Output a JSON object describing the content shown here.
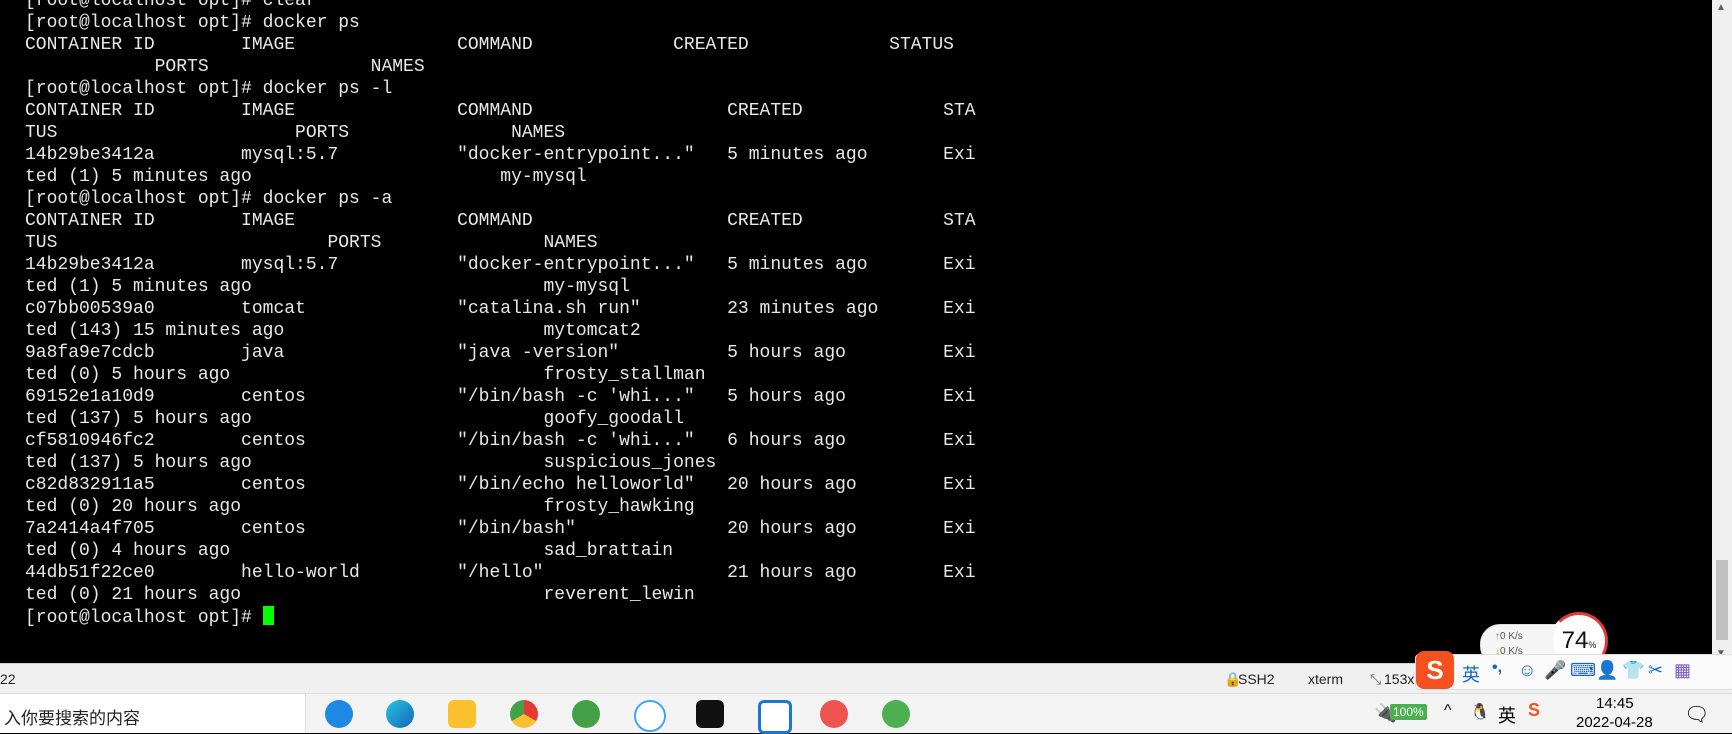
{
  "terminal": {
    "lines": [
      "[root@localhost opt]# clear",
      "[root@localhost opt]# docker ps",
      "CONTAINER ID        IMAGE               COMMAND             CREATED             STATUS",
      "            PORTS               NAMES",
      "[root@localhost opt]# docker ps -l",
      "CONTAINER ID        IMAGE               COMMAND                  CREATED             STA",
      "TUS                      PORTS               NAMES",
      "14b29be3412a        mysql:5.7           \"docker-entrypoint...\"   5 minutes ago       Exi",
      "ted (1) 5 minutes ago                       my-mysql",
      "[root@localhost opt]# docker ps -a",
      "CONTAINER ID        IMAGE               COMMAND                  CREATED             STA",
      "TUS                         PORTS               NAMES",
      "14b29be3412a        mysql:5.7           \"docker-entrypoint...\"   5 minutes ago       Exi",
      "ted (1) 5 minutes ago                           my-mysql",
      "c07bb00539a0        tomcat              \"catalina.sh run\"        23 minutes ago      Exi",
      "ted (143) 15 minutes ago                        mytomcat2",
      "9a8fa9e7cdcb        java                \"java -version\"          5 hours ago         Exi",
      "ted (0) 5 hours ago                             frosty_stallman",
      "69152e1a10d9        centos              \"/bin/bash -c 'whi...\"   5 hours ago         Exi",
      "ted (137) 5 hours ago                           goofy_goodall",
      "cf5810946fc2        centos              \"/bin/bash -c 'whi...\"   6 hours ago         Exi",
      "ted (137) 5 hours ago                           suspicious_jones",
      "c82d832911a5        centos              \"/bin/echo helloworld\"   20 hours ago        Exi",
      "ted (0) 20 hours ago                            frosty_hawking",
      "7a2414a4f705        centos              \"/bin/bash\"              20 hours ago        Exi",
      "ted (0) 4 hours ago                             sad_brattain",
      "44db51f22ce0        hello-world         \"/hello\"                 21 hours ago        Exi",
      "ted (0) 21 hours ago                            reverent_lewin"
    ],
    "prompt": "[root@localhost opt]# "
  },
  "statusbar": {
    "left": "22",
    "protocol": "SSH2",
    "terminal_type": "xterm",
    "size": "153x"
  },
  "network_widget": {
    "up": "0  K/s",
    "down": "0  K/s",
    "cpu": "74",
    "cpu_unit": "%"
  },
  "ime": {
    "lang": "英",
    "punct": "•,"
  },
  "taskbar": {
    "search_placeholder": "入你要搜索的内容",
    "battery": "100%",
    "ime_indicator": "英",
    "time": "14:45",
    "date": "2022-04-28"
  },
  "colors": {
    "cursor": "#00ff00",
    "terminal_bg": "#000000",
    "terminal_fg": "#e8e8e8",
    "cpu_ring": "#e53935",
    "sogou": "#f4511e"
  }
}
